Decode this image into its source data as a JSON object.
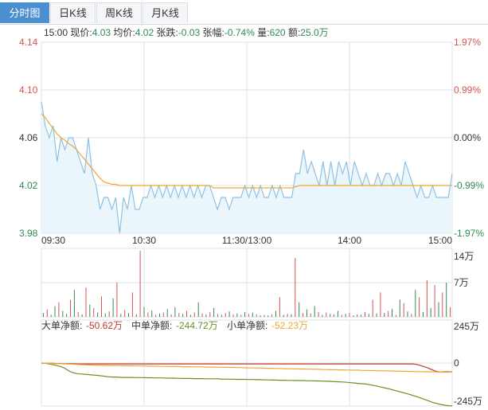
{
  "tabs": [
    {
      "label": "分时图",
      "active": true
    },
    {
      "label": "日K线",
      "active": false
    },
    {
      "label": "周K线",
      "active": false
    },
    {
      "label": "月K线",
      "active": false
    }
  ],
  "info": {
    "time": "15:00",
    "price_label": "现价:",
    "price": "4.03",
    "avg_label": "均价:",
    "avg": "4.02",
    "change_label": "张跌:",
    "change": "-0.03",
    "pct_label": "张幅:",
    "pct": "-0.74%",
    "vol_label": "量:",
    "vol": "620",
    "amt_label": "额:",
    "amt": "25.0万"
  },
  "colors": {
    "up": "#d9534f",
    "down": "#2e8b57",
    "price_line": "#8fc1e3",
    "price_fill": "#eaf5fc",
    "avg_line": "#f0a830",
    "grid": "#dde3ea",
    "big": "#c0392b",
    "mid": "#6b8e23",
    "small": "#f0a830"
  },
  "chart_data": [
    {
      "type": "line",
      "y_ticks_left": [
        "4.14",
        "4.10",
        "4.06",
        "4.02",
        "3.98"
      ],
      "y_ticks_right": [
        "1.97%",
        "0.99%",
        "0.00%",
        "-0.99%",
        "-1.97%"
      ],
      "x_ticks": [
        "09:30",
        "10:30",
        "11:30/13:00",
        "14:00",
        "15:00"
      ],
      "ylim": [
        3.98,
        4.14
      ],
      "prev_close": 4.06,
      "series": [
        {
          "name": "现价",
          "values": [
            4.09,
            4.07,
            4.06,
            4.07,
            4.04,
            4.06,
            4.05,
            4.06,
            4.06,
            4.05,
            4.04,
            4.03,
            4.06,
            4.03,
            4.02,
            4.0,
            4.01,
            4.01,
            4.0,
            4.01,
            3.98,
            4.01,
            4.0,
            4.02,
            4.0,
            4.0,
            4.01,
            4.01,
            4.02,
            4.01,
            4.02,
            4.01,
            4.02,
            4.01,
            4.02,
            4.01,
            4.02,
            4.01,
            4.02,
            4.01,
            4.02,
            4.01,
            4.02,
            4.02,
            4.01,
            4.0,
            4.01,
            4.01,
            4.0,
            4.01,
            4.01,
            4.01,
            4.02,
            4.01,
            4.02,
            4.01,
            4.02,
            4.01,
            4.01,
            4.02,
            4.01,
            4.02,
            4.01,
            4.01,
            4.01,
            4.03,
            4.03,
            4.05,
            4.03,
            4.04,
            4.03,
            4.02,
            4.04,
            4.02,
            4.04,
            4.02,
            4.04,
            4.03,
            4.04,
            4.02,
            4.04,
            4.03,
            4.02,
            4.03,
            4.02,
            4.02,
            4.03,
            4.02,
            4.03,
            4.03,
            4.02,
            4.03,
            4.02,
            4.04,
            4.03,
            4.02,
            4.01,
            4.02,
            4.01,
            4.01,
            4.02,
            4.01,
            4.01,
            4.01,
            4.01,
            4.03
          ]
        },
        {
          "name": "均价",
          "values": [
            4.08,
            4.077,
            4.072,
            4.068,
            4.063,
            4.06,
            4.058,
            4.055,
            4.053,
            4.05,
            4.046,
            4.042,
            4.038,
            4.034,
            4.03,
            4.026,
            4.023,
            4.022,
            4.021,
            4.021,
            4.02,
            4.02,
            4.02,
            4.02,
            4.02,
            4.02,
            4.02,
            4.02,
            4.02,
            4.02,
            4.02,
            4.02,
            4.02,
            4.02,
            4.02,
            4.02,
            4.02,
            4.02,
            4.02,
            4.02,
            4.02,
            4.02,
            4.02,
            4.02,
            4.018,
            4.018,
            4.018,
            4.018,
            4.018,
            4.018,
            4.018,
            4.018,
            4.018,
            4.018,
            4.018,
            4.018,
            4.018,
            4.018,
            4.018,
            4.018,
            4.018,
            4.018,
            4.018,
            4.018,
            4.018,
            4.019,
            4.02,
            4.02,
            4.02,
            4.02,
            4.02,
            4.02,
            4.02,
            4.02,
            4.02,
            4.02,
            4.02,
            4.02,
            4.02,
            4.02,
            4.02,
            4.02,
            4.02,
            4.02,
            4.02,
            4.02,
            4.02,
            4.02,
            4.02,
            4.02,
            4.02,
            4.02,
            4.02,
            4.02,
            4.02,
            4.02,
            4.02,
            4.02,
            4.02,
            4.02,
            4.02,
            4.02,
            4.02,
            4.02,
            4.02,
            4.02
          ]
        }
      ]
    },
    {
      "type": "bar",
      "y_ticks_right": [
        "14万",
        "7万"
      ],
      "ylim": [
        0,
        14
      ],
      "values": [
        0.8,
        1.5,
        0.4,
        2.2,
        3.0,
        1.2,
        0.6,
        3.5,
        5.5,
        1.0,
        0.5,
        6.0,
        2.5,
        1.8,
        0.9,
        4.2,
        0.7,
        1.1,
        3.8,
        7.0,
        0.6,
        1.4,
        0.8,
        5.0,
        0.5,
        13.5,
        2.0,
        0.9,
        1.3,
        0.4,
        0.7,
        0.9,
        1.6,
        0.5,
        2.0,
        0.8,
        0.6,
        1.2,
        0.4,
        0.9,
        3.0,
        0.7,
        0.5,
        1.0,
        1.8,
        0.6,
        0.4,
        0.8,
        1.1,
        0.5,
        0.7,
        0.4,
        1.0,
        0.6,
        0.9,
        0.5,
        0.3,
        0.4,
        0.3,
        0.5,
        1.2,
        4.0,
        0.4,
        0.6,
        0.5,
        12.0,
        3.0,
        0.8,
        1.5,
        0.7,
        2.2,
        1.0,
        0.4,
        0.9,
        0.6,
        0.5,
        1.2,
        0.4,
        0.6,
        0.8,
        0.3,
        0.5,
        0.4,
        1.0,
        0.6,
        3.5,
        0.7,
        5.0,
        0.8,
        1.2,
        1.6,
        0.4,
        3.5,
        2.8,
        1.1,
        0.6,
        5.5,
        4.0,
        1.0,
        7.5,
        1.8,
        6.5,
        3.0,
        5.0,
        7.0,
        2.0
      ],
      "colors": [
        "g",
        "r",
        "g",
        "g",
        "r",
        "g",
        "g",
        "r",
        "g",
        "r",
        "g",
        "r",
        "g",
        "r",
        "g",
        "r",
        "g",
        "r",
        "g",
        "r",
        "g",
        "r",
        "g",
        "r",
        "g",
        "r",
        "g",
        "r",
        "g",
        "r",
        "g",
        "r",
        "g",
        "r",
        "g",
        "r",
        "g",
        "r",
        "g",
        "r",
        "g",
        "r",
        "g",
        "r",
        "g",
        "r",
        "g",
        "r",
        "g",
        "r",
        "g",
        "r",
        "g",
        "r",
        "g",
        "r",
        "g",
        "r",
        "g",
        "r",
        "g",
        "r",
        "g",
        "r",
        "g",
        "r",
        "g",
        "r",
        "g",
        "r",
        "g",
        "r",
        "g",
        "r",
        "g",
        "r",
        "g",
        "r",
        "g",
        "r",
        "g",
        "r",
        "g",
        "r",
        "g",
        "r",
        "g",
        "r",
        "g",
        "r",
        "g",
        "r",
        "g",
        "r",
        "g",
        "r",
        "g",
        "r",
        "g",
        "r",
        "g",
        "r",
        "g",
        "r",
        "g",
        "r"
      ]
    },
    {
      "type": "line",
      "legend": [
        {
          "label": "大单净额:",
          "value": "-50.62万"
        },
        {
          "label": "中单净额:",
          "value": "-244.72万"
        },
        {
          "label": "小单净额:",
          "value": "-52.23万"
        }
      ],
      "y_ticks_right": [
        "245万",
        "0",
        "-245万"
      ],
      "ylim": [
        -245,
        245
      ],
      "series": [
        {
          "name": "大单净额",
          "values": [
            0,
            -1,
            -2,
            -2,
            -3,
            -3,
            -4,
            -4,
            -4,
            -5,
            -5,
            -5,
            -5,
            -5,
            -5,
            -5,
            -5,
            -5,
            -5,
            -5,
            -5,
            -5,
            -5,
            -5,
            -5,
            -5,
            -5,
            -5,
            -5,
            -5,
            -5,
            -5,
            -5,
            -5,
            -5,
            -5,
            -5,
            -5,
            -5,
            -5,
            -5,
            -5,
            -5,
            -5,
            -5,
            -5,
            -5,
            -5,
            -5,
            -5,
            -5,
            -5,
            -5,
            -5,
            -5,
            -5,
            -5,
            -5,
            -5,
            -5,
            -5,
            -5,
            -5,
            -5,
            -5,
            -5,
            -5,
            -5,
            -5,
            -5,
            -5,
            -5,
            -5,
            -5,
            -5,
            -5,
            -5,
            -5,
            -5,
            -5,
            -5,
            -5,
            -5,
            -5,
            -5,
            -5,
            -5,
            -5,
            -5,
            -5,
            -5,
            -5,
            -5,
            -5,
            -5,
            -5,
            -8,
            -15,
            -22,
            -30,
            -40,
            -48,
            -52,
            -50,
            -50,
            -50.62
          ]
        },
        {
          "name": "中单净额",
          "values": [
            0,
            -2,
            -5,
            -10,
            -15,
            -20,
            -30,
            -45,
            -55,
            -60,
            -62,
            -64,
            -66,
            -68,
            -70,
            -72,
            -75,
            -78,
            -80,
            -80,
            -81,
            -82,
            -82,
            -82,
            -83,
            -83,
            -83,
            -84,
            -84,
            -85,
            -85,
            -85,
            -86,
            -86,
            -86,
            -87,
            -88,
            -88,
            -88,
            -89,
            -89,
            -89,
            -90,
            -90,
            -90,
            -90,
            -91,
            -92,
            -92,
            -92,
            -93,
            -93,
            -93,
            -94,
            -94,
            -95,
            -95,
            -96,
            -96,
            -97,
            -97,
            -98,
            -98,
            -99,
            -99,
            -100,
            -100,
            -100,
            -101,
            -101,
            -102,
            -102,
            -103,
            -104,
            -105,
            -106,
            -107,
            -108,
            -110,
            -112,
            -114,
            -116,
            -118,
            -120,
            -124,
            -128,
            -133,
            -138,
            -143,
            -148,
            -154,
            -160,
            -166,
            -172,
            -178,
            -185,
            -192,
            -200,
            -208,
            -216,
            -224,
            -230,
            -236,
            -240,
            -243,
            -244.72
          ]
        },
        {
          "name": "小单净额",
          "values": [
            0,
            -1,
            -2,
            -3,
            -4,
            -4,
            -5,
            -6,
            -7,
            -8,
            -9,
            -10,
            -11,
            -12,
            -13,
            -13,
            -14,
            -14,
            -15,
            -15,
            -15,
            -16,
            -16,
            -16,
            -17,
            -17,
            -17,
            -18,
            -18,
            -18,
            -19,
            -19,
            -19,
            -20,
            -20,
            -20,
            -21,
            -21,
            -21,
            -22,
            -22,
            -22,
            -23,
            -23,
            -23,
            -24,
            -24,
            -24,
            -25,
            -25,
            -26,
            -26,
            -27,
            -27,
            -28,
            -28,
            -29,
            -29,
            -30,
            -30,
            -31,
            -31,
            -32,
            -32,
            -33,
            -33,
            -34,
            -34,
            -35,
            -35,
            -36,
            -36,
            -37,
            -37,
            -38,
            -38,
            -39,
            -39,
            -40,
            -40,
            -41,
            -41,
            -42,
            -42,
            -43,
            -43,
            -44,
            -44,
            -45,
            -45,
            -46,
            -46,
            -47,
            -47,
            -48,
            -48,
            -49,
            -49,
            -50,
            -50,
            -51,
            -51,
            -52,
            -52,
            -52.23,
            -52.23
          ]
        }
      ]
    }
  ]
}
